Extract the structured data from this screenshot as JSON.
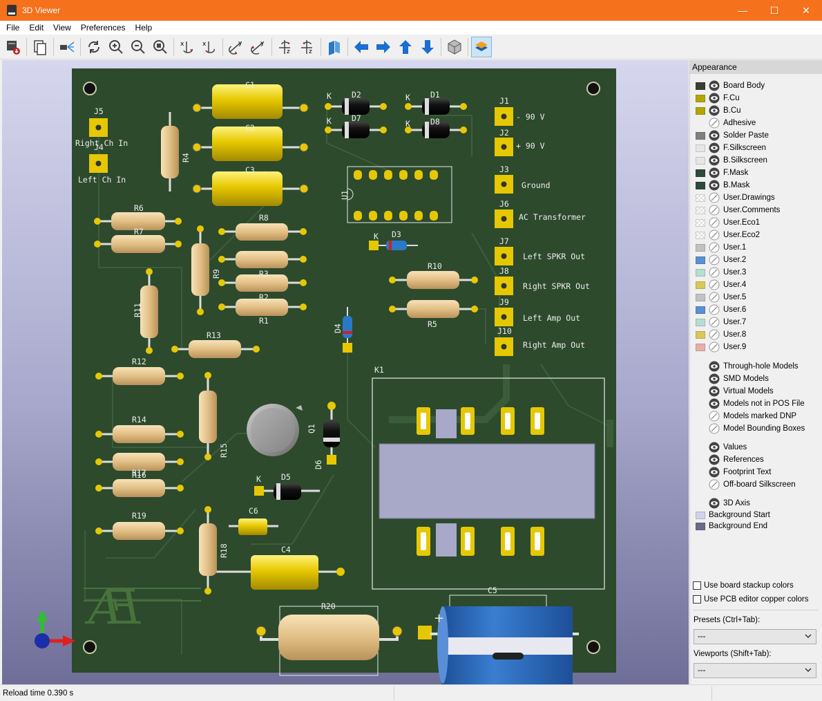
{
  "window": {
    "title": "3D Viewer",
    "buttons": {
      "minimize": "—",
      "maximize": "☐",
      "close": "✕"
    }
  },
  "menu": [
    "File",
    "Edit",
    "View",
    "Preferences",
    "Help"
  ],
  "toolbar": {
    "buttons": [
      "export-image",
      "copy-to-clipboard",
      "raytracing",
      "reload",
      "zoom-in",
      "zoom-out",
      "zoom-fit",
      "rotate-x-cw",
      "rotate-x-ccw",
      "rotate-y-cw",
      "rotate-y-ccw",
      "rotate-z-cw",
      "rotate-z-ccw",
      "flip-board",
      "pan-left",
      "pan-right",
      "pan-up",
      "pan-down",
      "toggle-orthographic",
      "show-layers-manager"
    ],
    "active": "show-layers-manager"
  },
  "board": {
    "references": [
      "J5",
      "J4",
      "J1",
      "J2",
      "J3",
      "J6",
      "J7",
      "J8",
      "J9",
      "J10",
      "C1",
      "C2",
      "C3",
      "C4",
      "C5",
      "C6",
      "D1",
      "D2",
      "D3",
      "D4",
      "D5",
      "D6",
      "D7",
      "D8",
      "R1",
      "R2",
      "R3",
      "R4",
      "R5",
      "R6",
      "R7",
      "R8",
      "R9",
      "R10",
      "R11",
      "R12",
      "R13",
      "R14",
      "R15",
      "R16",
      "R17",
      "R18",
      "R19",
      "R20",
      "U1",
      "K1",
      "Q1"
    ],
    "silk_texts": {
      "J5": "Right Ch In",
      "J4": "Left Ch In",
      "J1": "- 90 V",
      "J2": "+ 90 V",
      "J3": "Ground",
      "J6": "AC Transformer",
      "J7": "Left SPKR Out",
      "J8": "Right SPKR Out",
      "J9": "Left Amp Out",
      "J10": "Right Amp Out",
      "pin_k": "K"
    },
    "colors": {
      "mask": "#2d4a2d",
      "copper_pad": "#e6c800",
      "resistor_body": "#e8c995",
      "capacitor_yellow": "#e6c800",
      "electrolytic_blue": "#2a66b8",
      "relay_body": "#a8a8c8"
    }
  },
  "appearance": {
    "title": "Appearance",
    "layers": [
      {
        "name": "Board Body",
        "color": "#3e3d31",
        "eye": true
      },
      {
        "name": "F.Cu",
        "color": "#b5a500",
        "eye": true
      },
      {
        "name": "B.Cu",
        "color": "#b5a500",
        "eye": true
      },
      {
        "name": "Adhesive",
        "color": "",
        "eye": false
      },
      {
        "name": "Solder Paste",
        "color": "#808080",
        "eye": true
      },
      {
        "name": "F.Silkscreen",
        "color": "#e6e6e6",
        "eye": true
      },
      {
        "name": "B.Silkscreen",
        "color": "#e6e6e6",
        "eye": true
      },
      {
        "name": "F.Mask",
        "color": "#2d4a3d",
        "eye": true
      },
      {
        "name": "B.Mask",
        "color": "#2d4a3d",
        "eye": true
      },
      {
        "name": "User.Drawings",
        "color": "checker",
        "eye": false
      },
      {
        "name": "User.Comments",
        "color": "checker",
        "eye": false
      },
      {
        "name": "User.Eco1",
        "color": "checker",
        "eye": false
      },
      {
        "name": "User.Eco2",
        "color": "checker",
        "eye": false
      },
      {
        "name": "User.1",
        "color": "#c2c2c2",
        "eye": false
      },
      {
        "name": "User.2",
        "color": "#5b8fd6",
        "eye": false
      },
      {
        "name": "User.3",
        "color": "#b8dcd0",
        "eye": false
      },
      {
        "name": "User.4",
        "color": "#d8c85a",
        "eye": false
      },
      {
        "name": "User.5",
        "color": "#c2c2c2",
        "eye": false
      },
      {
        "name": "User.6",
        "color": "#5b8fd6",
        "eye": false
      },
      {
        "name": "User.7",
        "color": "#b8dcd0",
        "eye": false
      },
      {
        "name": "User.8",
        "color": "#d8c85a",
        "eye": false
      },
      {
        "name": "User.9",
        "color": "#e6b0a8",
        "eye": false
      }
    ],
    "model_options": [
      {
        "name": "Through-hole Models",
        "eye": true
      },
      {
        "name": "SMD Models",
        "eye": true
      },
      {
        "name": "Virtual Models",
        "eye": true
      },
      {
        "name": "Models not in POS File",
        "eye": true
      },
      {
        "name": "Models marked DNP",
        "eye": false
      },
      {
        "name": "Model Bounding Boxes",
        "eye": false
      }
    ],
    "text_options": [
      {
        "name": "Values",
        "eye": true
      },
      {
        "name": "References",
        "eye": true
      },
      {
        "name": "Footprint Text",
        "eye": true
      },
      {
        "name": "Off-board Silkscreen",
        "eye": false
      }
    ],
    "axis_option": {
      "name": "3D Axis",
      "eye": true
    },
    "backgrounds": [
      {
        "name": "Background Start",
        "color": "#d2d2ea"
      },
      {
        "name": "Background End",
        "color": "#6a6a8c"
      }
    ],
    "checkboxes": {
      "stackup": "Use board stackup colors",
      "copper": "Use PCB editor copper colors"
    },
    "presets_label": "Presets (Ctrl+Tab):",
    "presets_value": "---",
    "viewports_label": "Viewports (Shift+Tab):",
    "viewports_value": "---"
  },
  "status": {
    "reload_time": "Reload time 0.390 s"
  }
}
